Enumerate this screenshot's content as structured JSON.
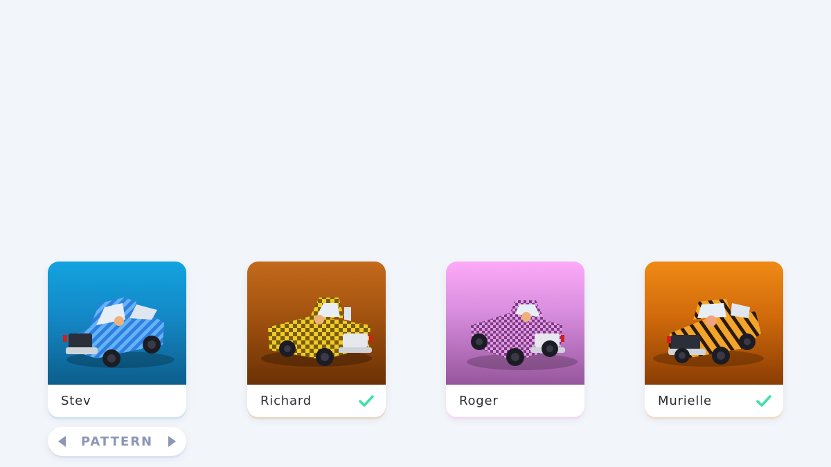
{
  "cars": [
    {
      "name": "Stev",
      "selected": false,
      "theme": "blue",
      "body_color": "#3a8fe8",
      "pattern": "diagonal-stripes",
      "glow": "#cfe3f3"
    },
    {
      "name": "Richard",
      "selected": true,
      "theme": "brown",
      "body_color": "#e8c21c",
      "pattern": "checker",
      "glow": "#e8d8c8"
    },
    {
      "name": "Roger",
      "selected": false,
      "theme": "pink",
      "body_color": "#d77fe0",
      "pattern": "checker",
      "glow": "#f7d8f6"
    },
    {
      "name": "Murielle",
      "selected": true,
      "theme": "orange",
      "body_color": "#f0a020",
      "pattern": "tiger-stripes",
      "glow": "#f2dccb"
    }
  ],
  "selector": {
    "label": "PATTERN",
    "prev_icon": "triangle-left-icon",
    "next_icon": "triangle-right-icon"
  },
  "colors": {
    "background": "#f2f5fa",
    "check": "#3ee0a8",
    "selector_text": "#8b96b8"
  }
}
